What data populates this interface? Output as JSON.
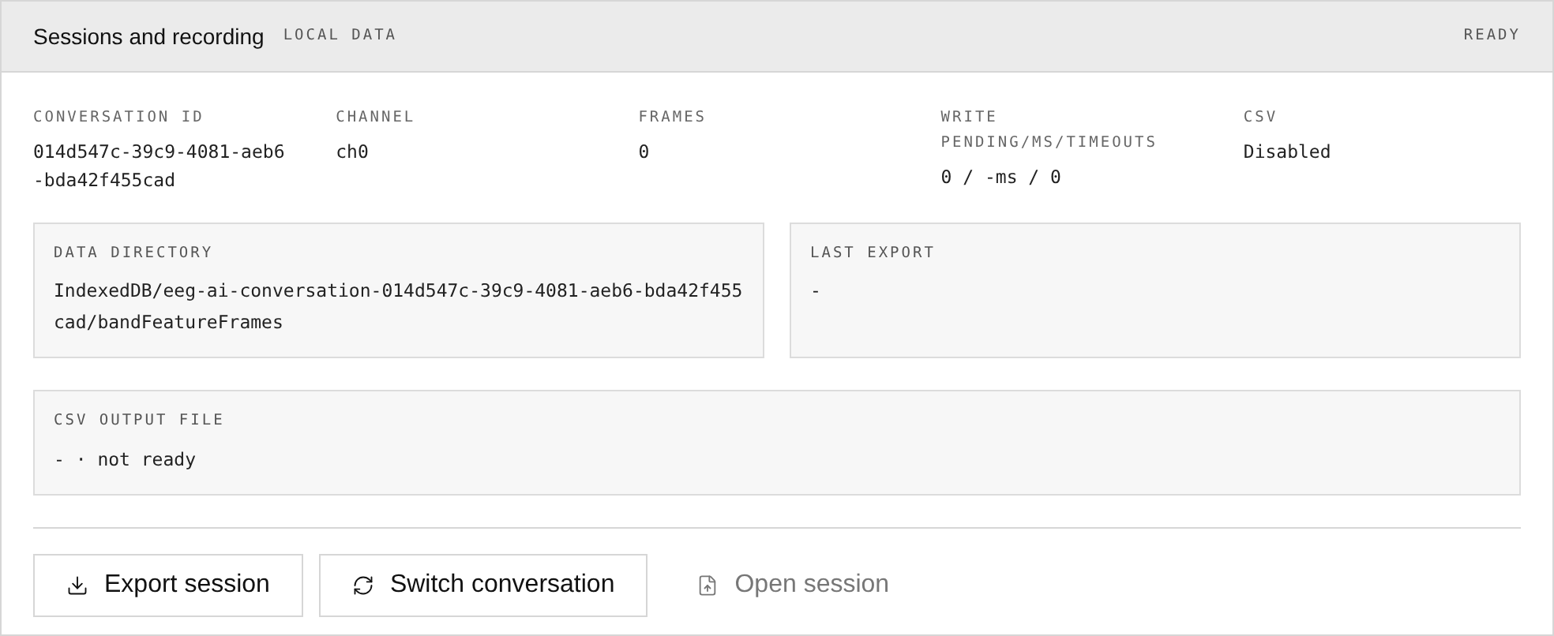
{
  "header": {
    "title": "Sessions and recording",
    "tag": "LOCAL DATA",
    "status": "READY"
  },
  "stats": [
    {
      "label": "CONVERSATION ID",
      "value": "014d547c-39c9-4081-aeb6-bda42f455cad"
    },
    {
      "label": "CHANNEL",
      "value": "ch0"
    },
    {
      "label": "FRAMES",
      "value": "0"
    },
    {
      "label": "WRITE PENDING/MS/TIMEOUTS",
      "value": "0 / -ms / 0"
    },
    {
      "label": "CSV",
      "value": "Disabled"
    }
  ],
  "panels": [
    {
      "label": "DATA DIRECTORY",
      "value": "IndexedDB/eeg-ai-conversation-014d547c-39c9-4081-aeb6-bda42f455cad/bandFeatureFrames"
    },
    {
      "label": "LAST EXPORT",
      "value": "-"
    },
    {
      "label": "CSV OUTPUT FILE",
      "value": "- · not ready"
    }
  ],
  "buttons": [
    {
      "label": "Export session",
      "kind": "export",
      "disabled": false
    },
    {
      "label": "Switch conversation",
      "kind": "switch",
      "disabled": false
    },
    {
      "label": "Open session",
      "kind": "open",
      "disabled": true
    }
  ]
}
